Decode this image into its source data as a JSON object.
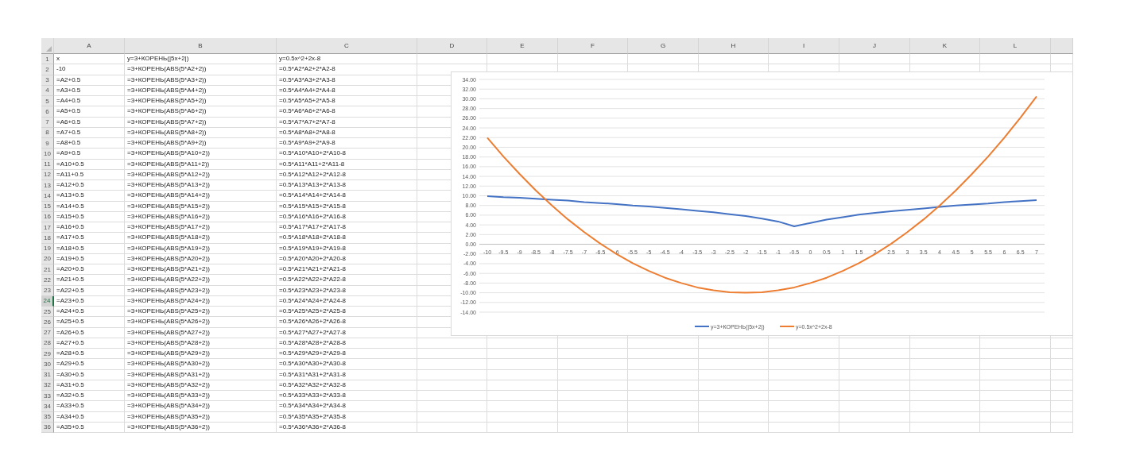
{
  "sheet": {
    "columns": [
      "A",
      "B",
      "C",
      "D",
      "E",
      "F",
      "G",
      "H",
      "I",
      "J",
      "K",
      "L"
    ],
    "rows": [
      {
        "number": "1",
        "selected": false,
        "cells": [
          "x",
          "y=3+КОРЕНЬ(|5x+2|)",
          "y=0.5x^2+2x-8"
        ]
      },
      {
        "number": "2",
        "selected": false,
        "cells": [
          "-10",
          "=3+КОРЕНЬ(ABS(5*A2+2))",
          "=0.5*A2*A2+2*A2-8"
        ]
      },
      {
        "number": "3",
        "selected": false,
        "cells": [
          "=A2+0.5",
          "=3+КОРЕНЬ(ABS(5*A3+2))",
          "=0.5*A3*A3+2*A3-8"
        ]
      },
      {
        "number": "4",
        "selected": false,
        "cells": [
          "=A3+0.5",
          "=3+КОРЕНЬ(ABS(5*A4+2))",
          "=0.5*A4*A4+2*A4-8"
        ]
      },
      {
        "number": "5",
        "selected": false,
        "cells": [
          "=A4+0.5",
          "=3+КОРЕНЬ(ABS(5*A5+2))",
          "=0.5*A5*A5+2*A5-8"
        ]
      },
      {
        "number": "6",
        "selected": false,
        "cells": [
          "=A5+0.5",
          "=3+КОРЕНЬ(ABS(5*A6+2))",
          "=0.5*A6*A6+2*A6-8"
        ]
      },
      {
        "number": "7",
        "selected": false,
        "cells": [
          "=A6+0.5",
          "=3+КОРЕНЬ(ABS(5*A7+2))",
          "=0.5*A7*A7+2*A7-8"
        ]
      },
      {
        "number": "8",
        "selected": false,
        "cells": [
          "=A7+0.5",
          "=3+КОРЕНЬ(ABS(5*A8+2))",
          "=0.5*A8*A8+2*A8-8"
        ]
      },
      {
        "number": "9",
        "selected": false,
        "cells": [
          "=A8+0.5",
          "=3+КОРЕНЬ(ABS(5*A9+2))",
          "=0.5*A9*A9+2*A9-8"
        ]
      },
      {
        "number": "10",
        "selected": false,
        "cells": [
          "=A9+0.5",
          "=3+КОРЕНЬ(ABS(5*A10+2))",
          "=0.5*A10*A10+2*A10-8"
        ]
      },
      {
        "number": "11",
        "selected": false,
        "cells": [
          "=A10+0.5",
          "=3+КОРЕНЬ(ABS(5*A11+2))",
          "=0.5*A11*A11+2*A11-8"
        ]
      },
      {
        "number": "12",
        "selected": false,
        "cells": [
          "=A11+0.5",
          "=3+КОРЕНЬ(ABS(5*A12+2))",
          "=0.5*A12*A12+2*A12-8"
        ]
      },
      {
        "number": "13",
        "selected": false,
        "cells": [
          "=A12+0.5",
          "=3+КОРЕНЬ(ABS(5*A13+2))",
          "=0.5*A13*A13+2*A13-8"
        ]
      },
      {
        "number": "14",
        "selected": false,
        "cells": [
          "=A13+0.5",
          "=3+КОРЕНЬ(ABS(5*A14+2))",
          "=0.5*A14*A14+2*A14-8"
        ]
      },
      {
        "number": "15",
        "selected": false,
        "cells": [
          "=A14+0.5",
          "=3+КОРЕНЬ(ABS(5*A15+2))",
          "=0.5*A15*A15+2*A15-8"
        ]
      },
      {
        "number": "16",
        "selected": false,
        "cells": [
          "=A15+0.5",
          "=3+КОРЕНЬ(ABS(5*A16+2))",
          "=0.5*A16*A16+2*A16-8"
        ]
      },
      {
        "number": "17",
        "selected": false,
        "cells": [
          "=A16+0.5",
          "=3+КОРЕНЬ(ABS(5*A17+2))",
          "=0.5*A17*A17+2*A17-8"
        ]
      },
      {
        "number": "18",
        "selected": false,
        "cells": [
          "=A17+0.5",
          "=3+КОРЕНЬ(ABS(5*A18+2))",
          "=0.5*A18*A18+2*A18-8"
        ]
      },
      {
        "number": "19",
        "selected": false,
        "cells": [
          "=A18+0.5",
          "=3+КОРЕНЬ(ABS(5*A19+2))",
          "=0.5*A19*A19+2*A19-8"
        ]
      },
      {
        "number": "20",
        "selected": false,
        "cells": [
          "=A19+0.5",
          "=3+КОРЕНЬ(ABS(5*A20+2))",
          "=0.5*A20*A20+2*A20-8"
        ]
      },
      {
        "number": "21",
        "selected": false,
        "cells": [
          "=A20+0.5",
          "=3+КОРЕНЬ(ABS(5*A21+2))",
          "=0.5*A21*A21+2*A21-8"
        ]
      },
      {
        "number": "22",
        "selected": false,
        "cells": [
          "=A21+0.5",
          "=3+КОРЕНЬ(ABS(5*A22+2))",
          "=0.5*A22*A22+2*A22-8"
        ]
      },
      {
        "number": "23",
        "selected": false,
        "cells": [
          "=A22+0.5",
          "=3+КОРЕНЬ(ABS(5*A23+2))",
          "=0.5*A23*A23+2*A23-8"
        ]
      },
      {
        "number": "24",
        "selected": true,
        "cells": [
          "=A23+0.5",
          "=3+КОРЕНЬ(ABS(5*A24+2))",
          "=0.5*A24*A24+2*A24-8"
        ]
      },
      {
        "number": "25",
        "selected": false,
        "cells": [
          "=A24+0.5",
          "=3+КОРЕНЬ(ABS(5*A25+2))",
          "=0.5*A25*A25+2*A25-8"
        ]
      },
      {
        "number": "26",
        "selected": false,
        "cells": [
          "=A25+0.5",
          "=3+КОРЕНЬ(ABS(5*A26+2))",
          "=0.5*A26*A26+2*A26-8"
        ]
      },
      {
        "number": "27",
        "selected": false,
        "cells": [
          "=A26+0.5",
          "=3+КОРЕНЬ(ABS(5*A27+2))",
          "=0.5*A27*A27+2*A27-8"
        ]
      },
      {
        "number": "28",
        "selected": false,
        "cells": [
          "=A27+0.5",
          "=3+КОРЕНЬ(ABS(5*A28+2))",
          "=0.5*A28*A28+2*A28-8"
        ]
      },
      {
        "number": "29",
        "selected": false,
        "cells": [
          "=A28+0.5",
          "=3+КОРЕНЬ(ABS(5*A29+2))",
          "=0.5*A29*A29+2*A29-8"
        ]
      },
      {
        "number": "30",
        "selected": false,
        "cells": [
          "=A29+0.5",
          "=3+КОРЕНЬ(ABS(5*A30+2))",
          "=0.5*A30*A30+2*A30-8"
        ]
      },
      {
        "number": "31",
        "selected": false,
        "cells": [
          "=A30+0.5",
          "=3+КОРЕНЬ(ABS(5*A31+2))",
          "=0.5*A31*A31+2*A31-8"
        ]
      },
      {
        "number": "32",
        "selected": false,
        "cells": [
          "=A31+0.5",
          "=3+КОРЕНЬ(ABS(5*A32+2))",
          "=0.5*A32*A32+2*A32-8"
        ]
      },
      {
        "number": "33",
        "selected": false,
        "cells": [
          "=A32+0.5",
          "=3+КОРЕНЬ(ABS(5*A33+2))",
          "=0.5*A33*A33+2*A33-8"
        ]
      },
      {
        "number": "34",
        "selected": false,
        "cells": [
          "=A33+0.5",
          "=3+КОРЕНЬ(ABS(5*A34+2))",
          "=0.5*A34*A34+2*A34-8"
        ]
      },
      {
        "number": "35",
        "selected": false,
        "cells": [
          "=A34+0.5",
          "=3+КОРЕНЬ(ABS(5*A35+2))",
          "=0.5*A35*A35+2*A35-8"
        ]
      },
      {
        "number": "36",
        "selected": false,
        "cells": [
          "=A35+0.5",
          "=3+КОРЕНЬ(ABS(5*A36+2))",
          "=0.5*A36*A36+2*A36-8"
        ]
      }
    ]
  },
  "chart": {
    "chart_data": {
      "type": "line",
      "categories": [
        "-10",
        "-9.5",
        "-9",
        "-8.5",
        "-8",
        "-7.5",
        "-7",
        "-6.5",
        "-6",
        "-5.5",
        "-5",
        "-4.5",
        "-4",
        "-3.5",
        "-3",
        "-2.5",
        "-2",
        "-1.5",
        "-1",
        "-0.5",
        "0",
        "0.5",
        "1",
        "1.5",
        "2",
        "2.5",
        "3",
        "3.5",
        "4",
        "4.5",
        "5",
        "5.5",
        "6",
        "6.5",
        "7"
      ],
      "series": [
        {
          "name": "y=3+КОРЕНЬ(|5x+2|)",
          "color": "#4472c4",
          "values": [
            9.9,
            9.7,
            9.6,
            9.4,
            9.2,
            9,
            8.7,
            8.5,
            8.3,
            8,
            7.8,
            7.5,
            7.2,
            6.9,
            6.6,
            6.2,
            5.8,
            5.3,
            4.7,
            3.7,
            4.4,
            5.1,
            5.6,
            6.1,
            6.5,
            6.8,
            7.1,
            7.4,
            7.7,
            8,
            8.2,
            8.4,
            8.7,
            8.9,
            9.1
          ]
        },
        {
          "name": "y=0.5x^2+2x-8",
          "color": "#ed7d31",
          "values": [
            22,
            18.1,
            14.5,
            11.1,
            8,
            5.1,
            2.5,
            0.1,
            -2,
            -3.9,
            -5.5,
            -6.9,
            -8,
            -8.9,
            -9.5,
            -9.9,
            -10,
            -9.9,
            -9.5,
            -8.9,
            -8,
            -6.9,
            -5.5,
            -3.9,
            -2,
            0.1,
            2.5,
            5.1,
            8,
            11.1,
            14.5,
            18.1,
            22,
            26.1,
            30.5
          ]
        }
      ],
      "grid": true,
      "legend": true,
      "ylim": [
        -14,
        34
      ],
      "yticks": [
        {
          "value": -14,
          "label": "-14.00"
        },
        {
          "value": -12,
          "label": "-12.00"
        },
        {
          "value": -10,
          "label": "-10.00"
        },
        {
          "value": -8,
          "label": "-8.00"
        },
        {
          "value": -6,
          "label": "-6.00"
        },
        {
          "value": -4,
          "label": "-4.00"
        },
        {
          "value": -2,
          "label": "-2.00"
        },
        {
          "value": 0,
          "label": "0.00"
        },
        {
          "value": 2,
          "label": "2.00"
        },
        {
          "value": 4,
          "label": "4.00"
        },
        {
          "value": 6,
          "label": "6.00"
        },
        {
          "value": 8,
          "label": "8.00"
        },
        {
          "value": 10,
          "label": "10.00"
        },
        {
          "value": 12,
          "label": "12.00"
        },
        {
          "value": 14,
          "label": "14.00"
        },
        {
          "value": 16,
          "label": "16.00"
        },
        {
          "value": 18,
          "label": "18.00"
        },
        {
          "value": 20,
          "label": "20.00"
        },
        {
          "value": 22,
          "label": "22.00"
        },
        {
          "value": 24,
          "label": "24.00"
        },
        {
          "value": 26,
          "label": "26.00"
        },
        {
          "value": 28,
          "label": "28.00"
        },
        {
          "value": 30,
          "label": "30.00"
        },
        {
          "value": 32,
          "label": "32.00"
        },
        {
          "value": 34,
          "label": "34.00"
        }
      ]
    }
  }
}
